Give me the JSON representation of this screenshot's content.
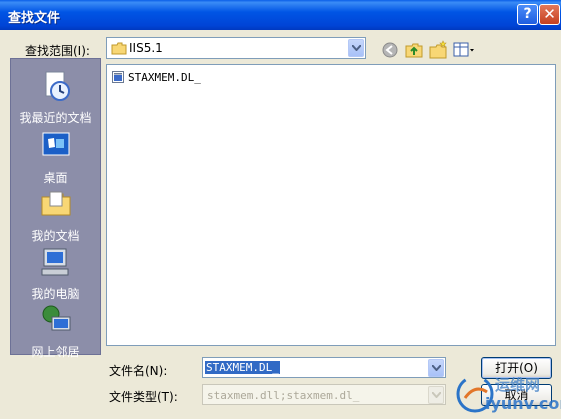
{
  "window": {
    "title": "查找文件",
    "help_glyph": "?",
    "close_glyph": "✕"
  },
  "toolbar": {
    "look_in_label": "查找范围(I):",
    "look_in_value": "IIS5.1",
    "icons": [
      "back-icon",
      "up-folder-icon",
      "new-folder-icon",
      "view-menu-icon"
    ]
  },
  "places": [
    {
      "label": "我最近的文档",
      "icon": "recent-documents-icon"
    },
    {
      "label": "桌面",
      "icon": "desktop-icon"
    },
    {
      "label": "我的文档",
      "icon": "my-documents-icon"
    },
    {
      "label": "我的电脑",
      "icon": "my-computer-icon"
    },
    {
      "label": "网上邻居",
      "icon": "network-places-icon"
    }
  ],
  "files": [
    {
      "name": "STAXMEM.DL_",
      "icon": "file-icon"
    }
  ],
  "filename": {
    "label": "文件名(N):",
    "value": "STAXMEM.DL_"
  },
  "filetype": {
    "label": "文件类型(T):",
    "value": "staxmem.dll;staxmem.dl_"
  },
  "buttons": {
    "open": "打开(O)",
    "cancel": "取消"
  },
  "watermark": {
    "line1": "运维网",
    "line2": "iyunv.com"
  },
  "colors": {
    "titlebar": "#0055E5",
    "dialog_bg": "#ECE9D8",
    "places_bg": "#8C8EA9",
    "selection": "#316AC5"
  }
}
